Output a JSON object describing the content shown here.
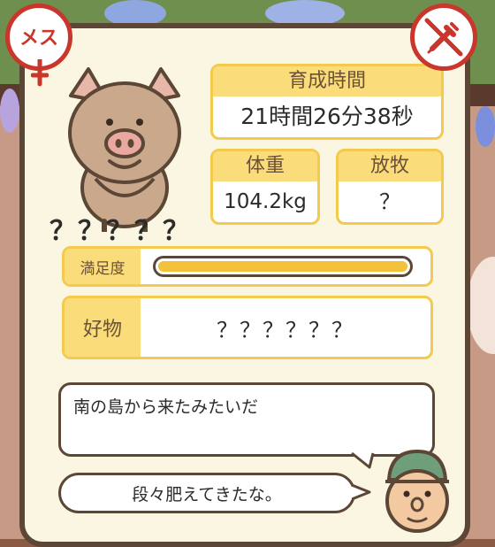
{
  "sex_badge": {
    "label": "メス",
    "color": "#c9362c"
  },
  "no_medicine_badge": {
    "icon": "no-syringe-icon",
    "color": "#c9362c"
  },
  "pig": {
    "name": "？？？？？"
  },
  "stats": {
    "time_label": "育成時間",
    "time_value": "21時間26分38秒",
    "weight_label": "体重",
    "weight_value": "104.2kg",
    "pasture_label": "放牧",
    "pasture_value": "？"
  },
  "satisfaction": {
    "label": "満足度",
    "level": 1.0,
    "color": "#f4c13a"
  },
  "favorite": {
    "label": "好物",
    "value": "？？？？？？"
  },
  "dialogue": {
    "origin": "南の島から来たみたいだ",
    "comment": "段々肥えてきたな。"
  }
}
